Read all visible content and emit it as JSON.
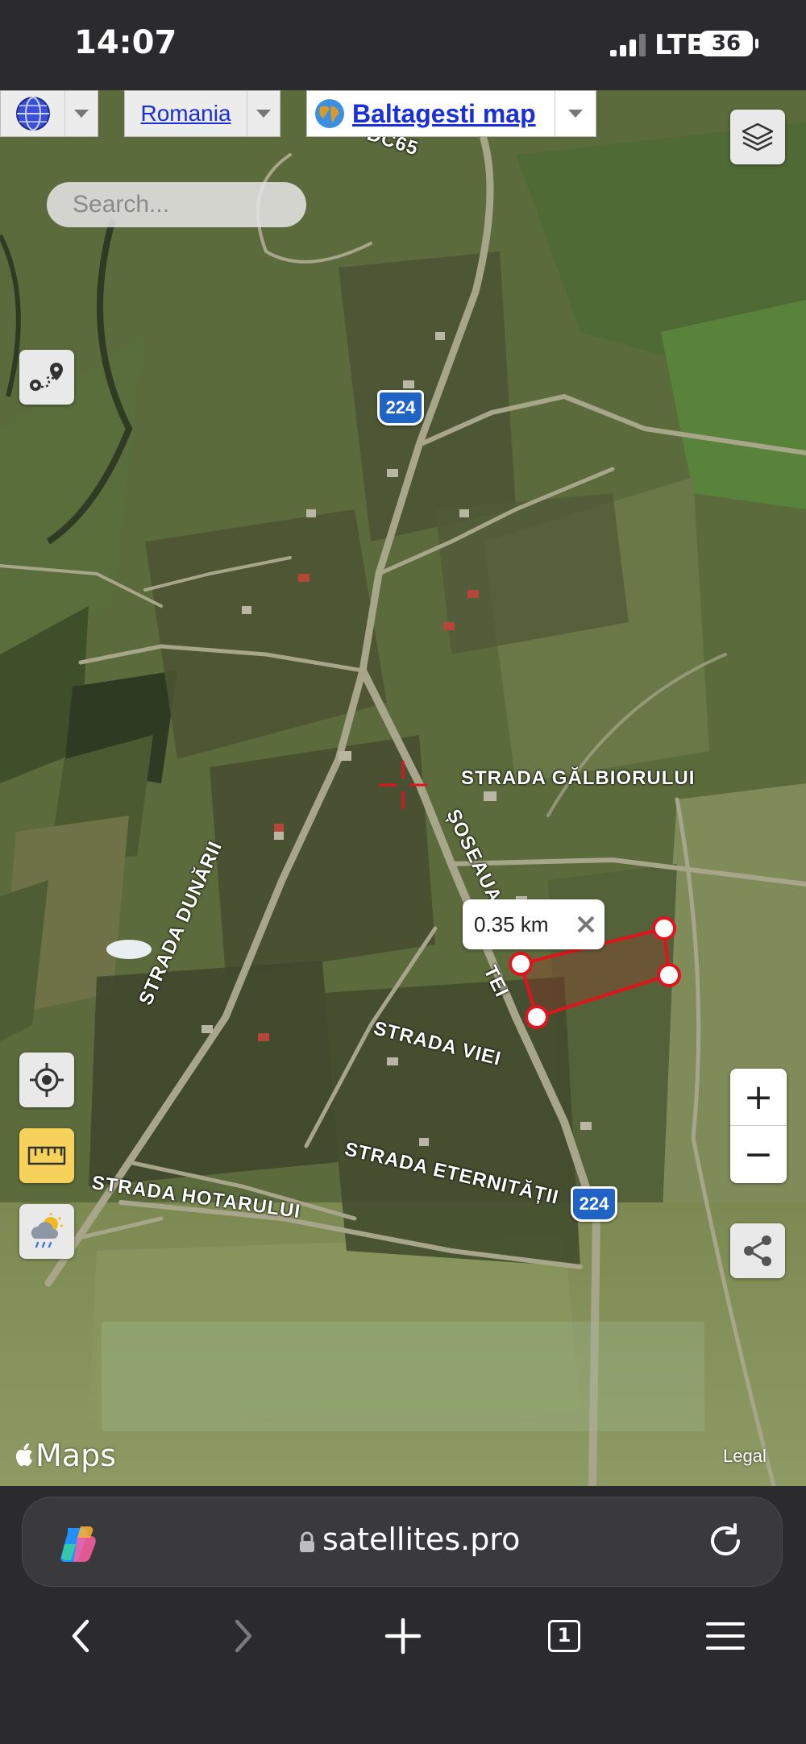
{
  "status_bar": {
    "time": "14:07",
    "network": "LTE",
    "battery": "36"
  },
  "map": {
    "country_select": "Romania",
    "map_select": "Baltagesti map",
    "search_placeholder": "Search...",
    "measurement": "0.35 km",
    "road_labels": {
      "dc65": "DC65",
      "strada_galbiorului": "STRADA GĂLBIORULUI",
      "soseaua": "ȘOSEAUA",
      "sos_tail": "TEI",
      "strada_dunarii": "STRADA DUNĂRII",
      "strada_viei": "STRADA VIEI",
      "strada_eternitatii": "STRADA ETERNITĂȚII",
      "strada_hotarului": "STRADA HOTARULUI"
    },
    "route_shields": [
      "224",
      "224"
    ],
    "zoom_in": "+",
    "zoom_out": "−",
    "attribution": "Maps",
    "legal": "Legal",
    "buttons": [
      "globe-icon",
      "layers-icon",
      "route-icon",
      "locate-icon",
      "ruler-icon",
      "weather-icon",
      "share-icon"
    ],
    "accent_measure": "#e0141c",
    "accent_ruler": "#f6d25a"
  },
  "browser": {
    "url": "satellites.pro",
    "tab_count": "1",
    "icons": [
      "copilot-icon",
      "lock-icon",
      "reload-icon",
      "back-icon",
      "forward-icon",
      "new-tab-icon",
      "tabs-icon",
      "menu-icon"
    ]
  }
}
